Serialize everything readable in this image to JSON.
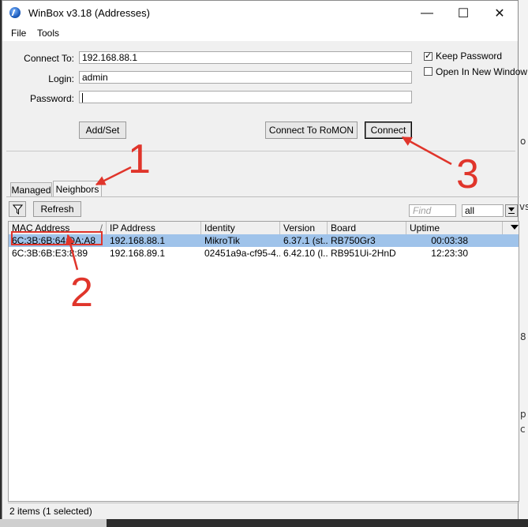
{
  "window": {
    "title": "WinBox v3.18 (Addresses)",
    "minimize_glyph": "—",
    "maximize_glyph": "☐",
    "close_glyph": "✕"
  },
  "menu": {
    "file": "File",
    "tools": "Tools"
  },
  "form": {
    "connect_to_label": "Connect To:",
    "connect_to_value": "192.168.88.1",
    "login_label": "Login:",
    "login_value": "admin",
    "password_label": "Password:",
    "password_value": "",
    "keep_password_label": "Keep Password",
    "keep_password_checked": true,
    "open_new_window_label": "Open In New Window",
    "open_new_window_checked": false,
    "add_set_label": "Add/Set",
    "connect_romon_label": "Connect To RoMON",
    "connect_label": "Connect"
  },
  "tabs": [
    {
      "label": "Managed",
      "active": false
    },
    {
      "label": "Neighbors",
      "active": true
    }
  ],
  "toolbar": {
    "refresh_label": "Refresh",
    "find_placeholder": "Find",
    "filter_value": "all"
  },
  "table": {
    "columns": [
      "MAC Address",
      "IP Address",
      "Identity",
      "Version",
      "Board",
      "Uptime"
    ],
    "sort_indicator": "/",
    "rows": [
      {
        "mac": "6C:3B:6B:64:DA:A8",
        "ip": "192.168.88.1",
        "identity": "MikroTik",
        "version": "6.37.1 (st...",
        "board": "RB750Gr3",
        "uptime": "00:03:38",
        "selected": true
      },
      {
        "mac": "6C:3B:6B:E3:8:89",
        "ip": "192.168.89.1",
        "identity": "02451a9a-cf95-4...",
        "version": "6.42.10 (l...",
        "board": "RB951Ui-2HnD",
        "uptime": "12:23:30",
        "selected": false
      }
    ]
  },
  "status": "2 items (1 selected)",
  "annotations": {
    "one": "1",
    "two": "2",
    "three": "3",
    "color": "#e0352b"
  },
  "colors": {
    "selection": "#9fc3ea",
    "accent": "#e0352b"
  }
}
